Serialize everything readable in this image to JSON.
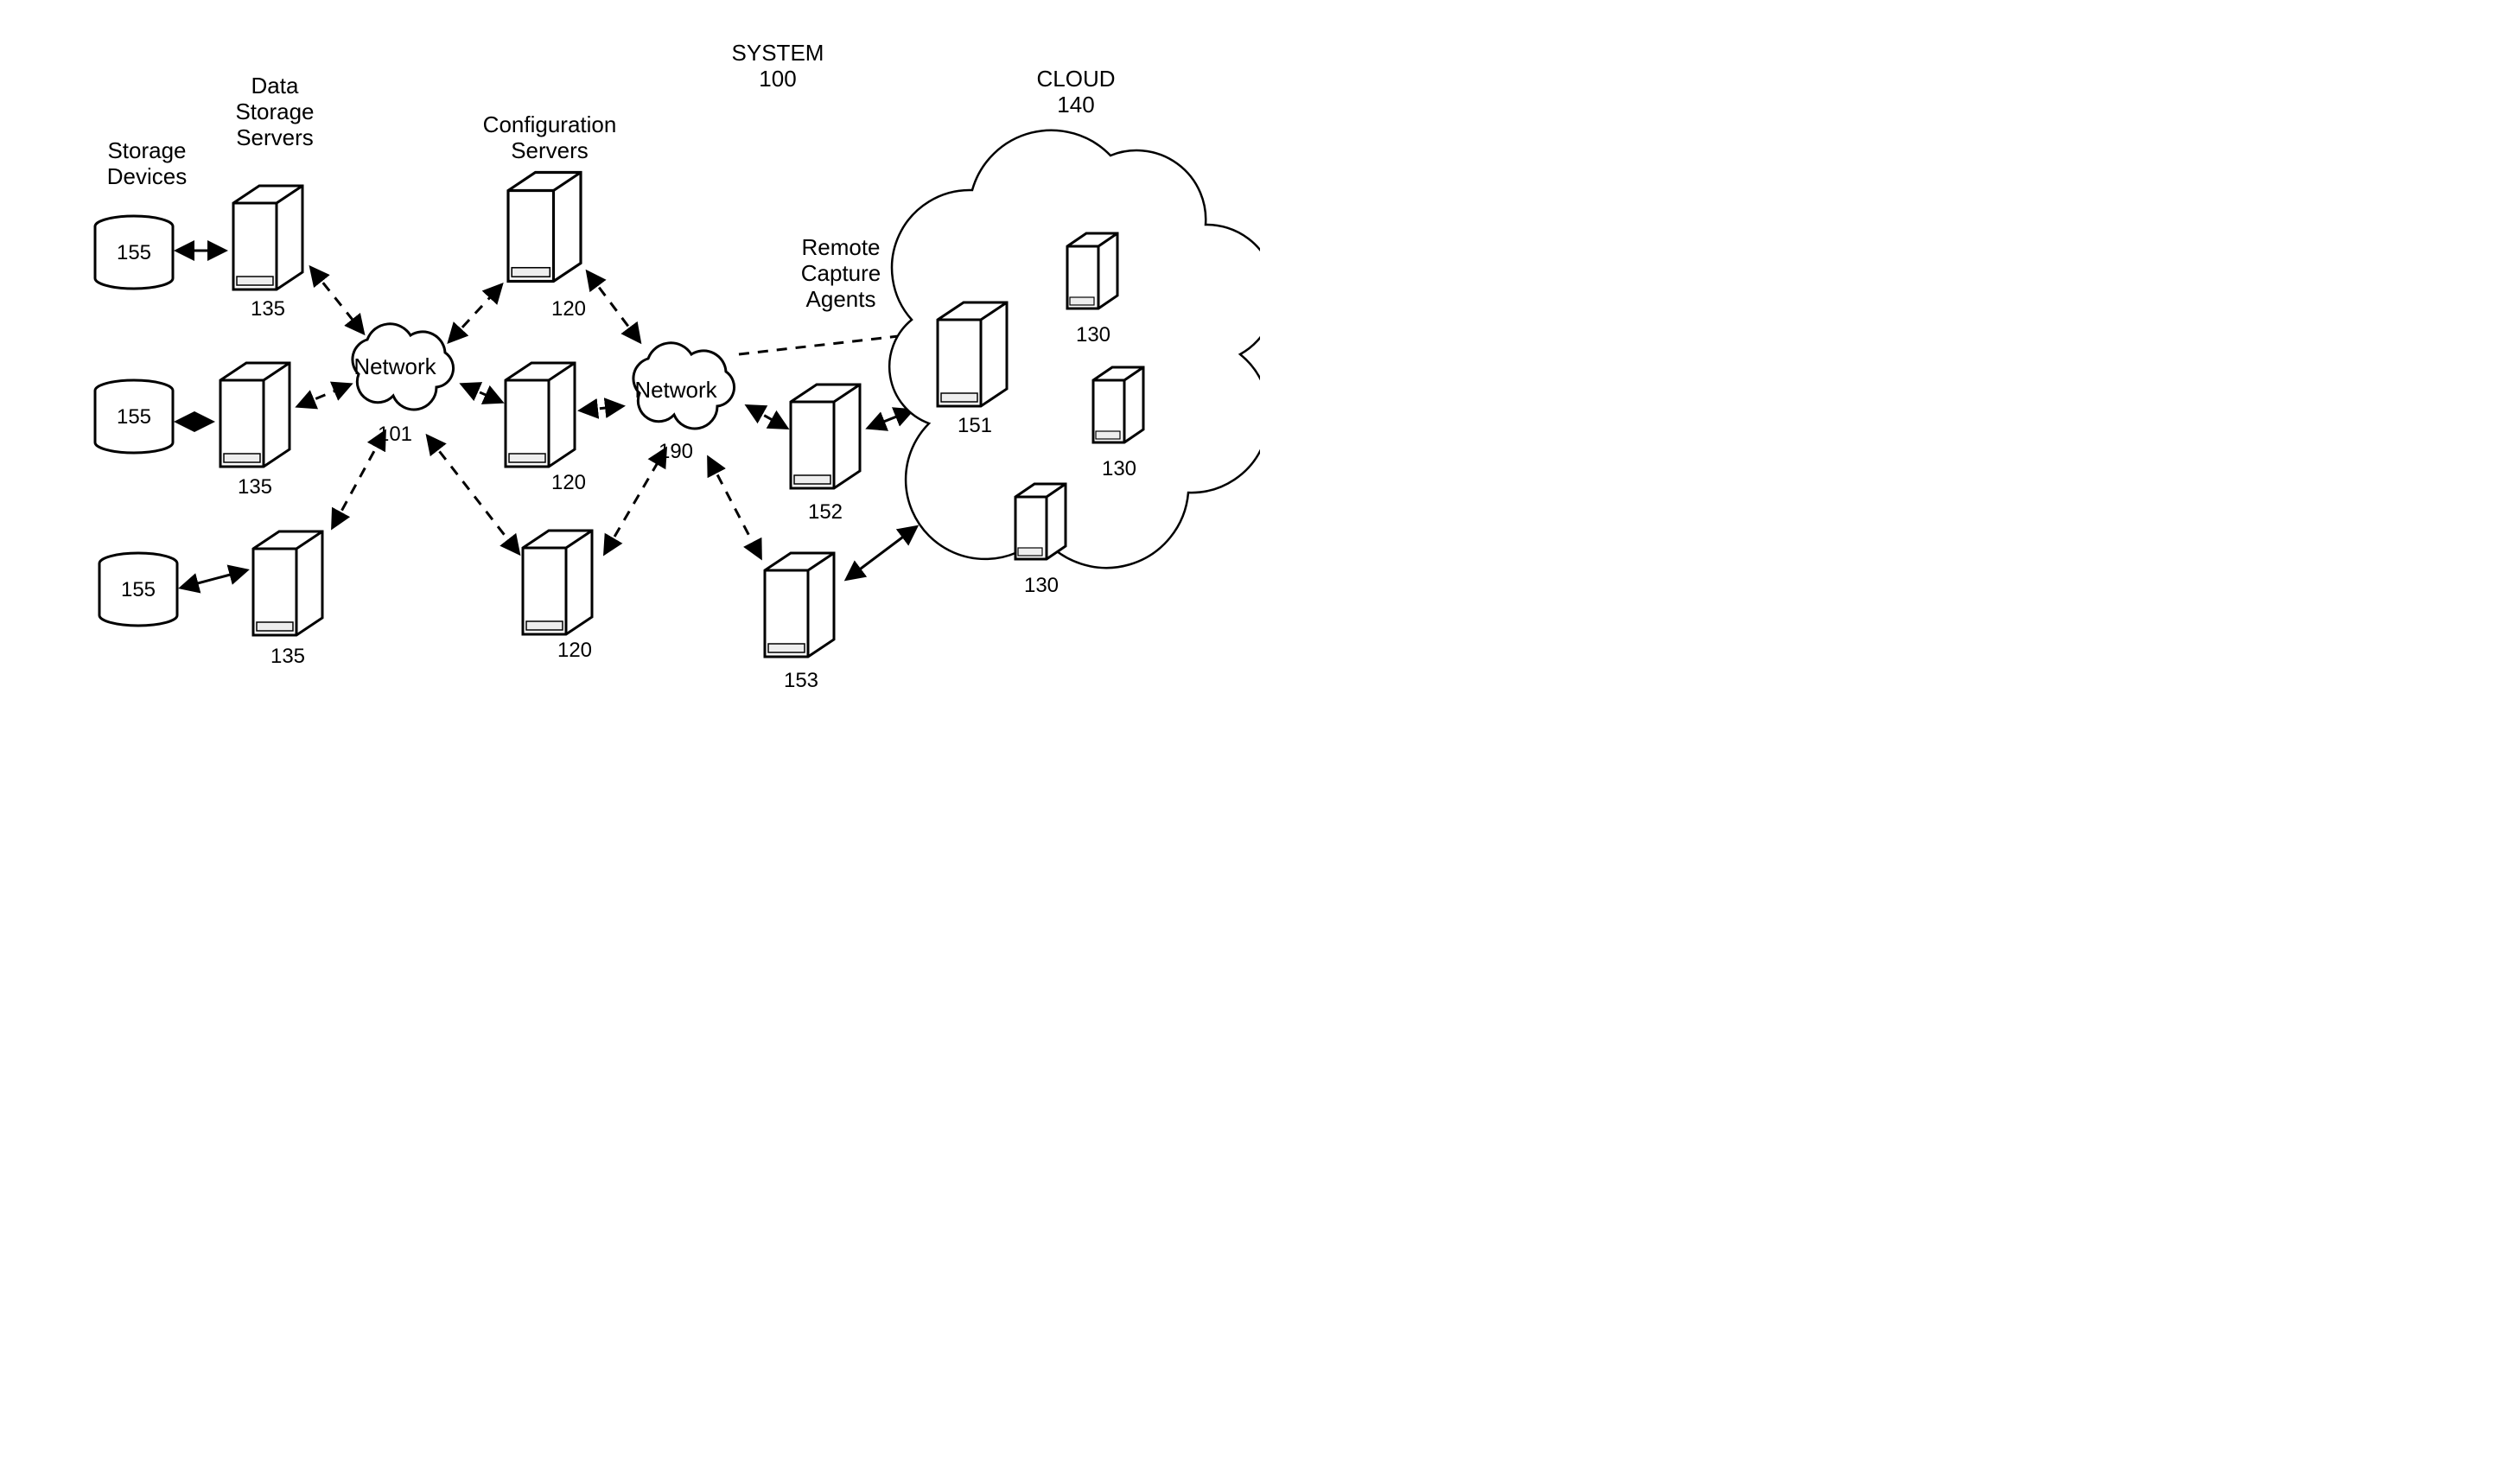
{
  "title": {
    "line1": "SYSTEM",
    "line2": "100"
  },
  "cloud": {
    "line1": "CLOUD",
    "line2": "140"
  },
  "networks": {
    "left": "Network",
    "leftRef": "101",
    "right": "Network",
    "rightRef": "190"
  },
  "labels": {
    "storageDevices": {
      "line1": "Storage",
      "line2": "Devices"
    },
    "dataStorageServers": {
      "line1": "Data",
      "line2": "Storage",
      "line3": "Servers"
    },
    "configServers": {
      "line1": "Configuration",
      "line2": "Servers"
    },
    "remoteCaptureAgents": {
      "line1": "Remote",
      "line2": "Capture",
      "line3": "Agents"
    }
  },
  "refs": {
    "storage": [
      "155",
      "155",
      "155"
    ],
    "dataStorage": [
      "135",
      "135",
      "135"
    ],
    "config": [
      "120",
      "120",
      "120"
    ],
    "agentsMid": [
      "152",
      "153"
    ],
    "cloudLeft": "151",
    "cloudRight": [
      "130",
      "130",
      "130"
    ]
  }
}
